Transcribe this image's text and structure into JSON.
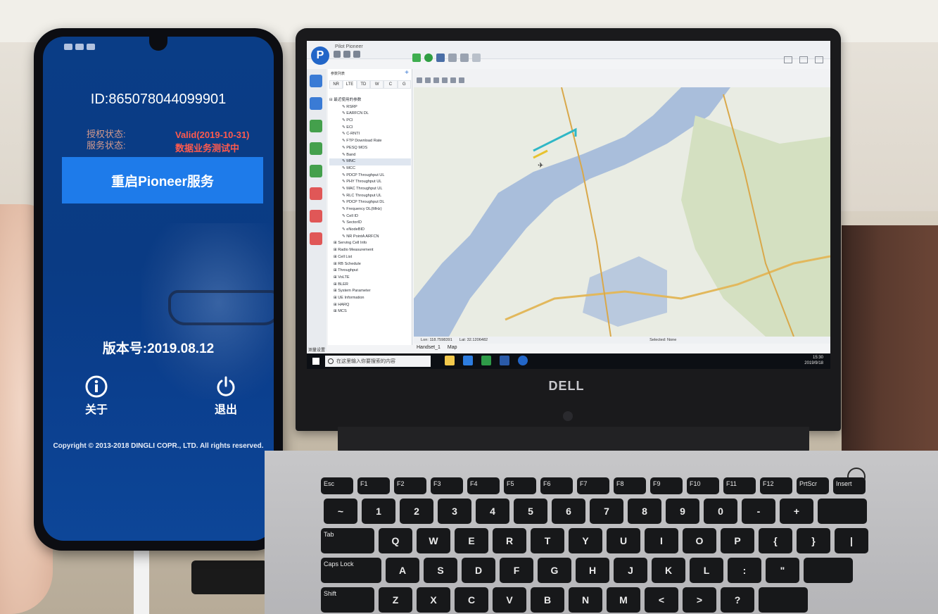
{
  "phone": {
    "device_id": "ID:865078044099901",
    "auth_label": "授权状态:",
    "auth_value": "Valid(2019-10-31)",
    "service_label": "服务状态:",
    "service_value": "数据业务测试中",
    "restart_button": "重启Pioneer服务",
    "version": "版本号:2019.08.12",
    "about_label": "关于",
    "exit_label": "退出",
    "copyright": "Copyright © 2013-2018 DINGLI COPR., LTD. All rights reserved."
  },
  "laptop": {
    "brand": "DELL",
    "app": {
      "window_title": "Pilot Pioneer",
      "panel_title": "参数列表",
      "tabs": [
        "NR",
        "LTE",
        "TD",
        "W",
        "C",
        "G"
      ],
      "active_tab": "LTE",
      "root_node": "最近使用的参数",
      "recent_params": [
        "RSRP",
        "EARFCN DL",
        "PCI",
        "ECI",
        "C-RNTI",
        "FTP Download Rate",
        "PESQ MOS",
        "Band",
        "MNC",
        "MCC",
        "PDCP Throughput UL",
        "PHY Throughput UL",
        "MAC Throughput UL",
        "RLC Throughput UL",
        "PDCP Throughput DL",
        "Frequency DL(MHz)",
        "Cell ID",
        "SectorID",
        "eNodeBID",
        "NR PointA ARFCN"
      ],
      "groups": [
        "Serving Cell Info",
        "Radio Measurement",
        "Cell List",
        "RB Schedule",
        "Throughput",
        "VoLTE",
        "BLER",
        "System Parameter",
        "UE Information",
        "HARQ",
        "MCS"
      ],
      "bottom_panel_tab": "测量设置",
      "map_status_lon": "Lon: 118.7598391",
      "map_status_lat": "Lat: 32.1206482",
      "map_status_selected": "Selected: None",
      "doc_tabs": [
        "Handset_1",
        "Map"
      ],
      "search_placeholder": "在这里输入你要搜索的内容",
      "tray_time": "15:30",
      "tray_date": "2019/9/18"
    },
    "keyboard_rows": [
      [
        "Esc",
        "F1",
        "F2",
        "F3",
        "F4",
        "F5",
        "F6",
        "F7",
        "F8",
        "F9",
        "F10",
        "F11",
        "F12",
        "PrtScr",
        "Insert"
      ],
      [
        "~",
        "1",
        "2",
        "3",
        "4",
        "5",
        "6",
        "7",
        "8",
        "9",
        "0",
        "-",
        "+",
        ""
      ],
      [
        "Tab",
        "Q",
        "W",
        "E",
        "R",
        "T",
        "Y",
        "U",
        "I",
        "O",
        "P",
        "{",
        "}",
        "|"
      ],
      [
        "Caps Lock",
        "A",
        "S",
        "D",
        "F",
        "G",
        "H",
        "J",
        "K",
        "L",
        ":",
        "\"",
        ""
      ],
      [
        "Shift",
        "Z",
        "X",
        "C",
        "V",
        "B",
        "N",
        "M",
        "<",
        ">",
        "?",
        ""
      ]
    ]
  },
  "colors": {
    "phone_bg": "#0a3d86",
    "restart_button_bg": "#1e7bea",
    "status_value": "#ff5a4d",
    "map_water": "#9fb7d6",
    "map_land": "#d9e4c8",
    "map_road": "#e9c16b"
  }
}
